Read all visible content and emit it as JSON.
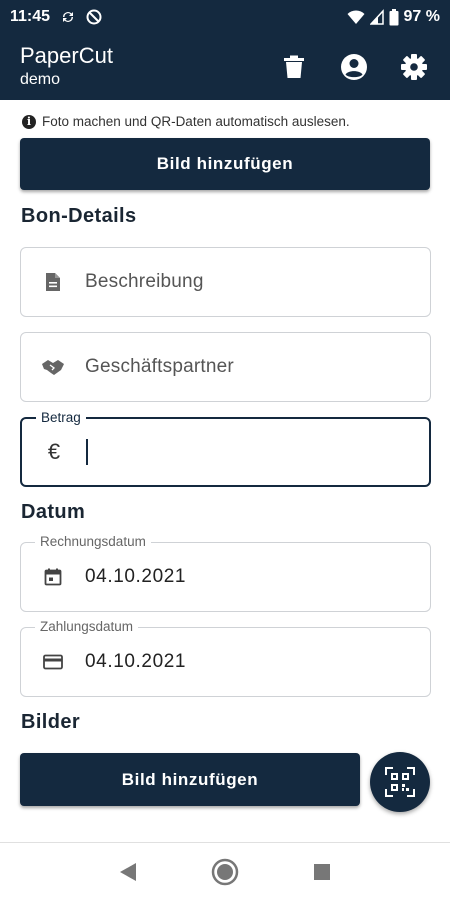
{
  "status_bar": {
    "time": "11:45",
    "battery": "97 %",
    "icons": [
      "sync-icon",
      "do-not-disturb-icon",
      "wifi-icon",
      "signal-icon",
      "battery-icon"
    ]
  },
  "app_bar": {
    "title": "PaperCut",
    "subtitle": "demo",
    "actions": [
      "delete-icon",
      "account-icon",
      "settings-icon"
    ]
  },
  "hint": {
    "text": "Foto machen und QR-Daten automatisch auslesen."
  },
  "buttons": {
    "add_image_top": "Bild hinzufügen",
    "add_image_bottom": "Bild hinzufügen"
  },
  "sections": {
    "receipt_details": "Bon-Details",
    "date": "Datum",
    "images": "Bilder"
  },
  "fields": {
    "description": {
      "placeholder": "Beschreibung"
    },
    "partner": {
      "placeholder": "Geschäftspartner"
    },
    "amount": {
      "label": "Betrag",
      "currency": "€",
      "value": ""
    },
    "invoice_date": {
      "label": "Rechnungsdatum",
      "value": "04.10.2021"
    },
    "payment_date": {
      "label": "Zahlungsdatum",
      "value": "04.10.2021"
    }
  },
  "colors": {
    "primary": "#14293f",
    "border": "#cfd2d6"
  }
}
